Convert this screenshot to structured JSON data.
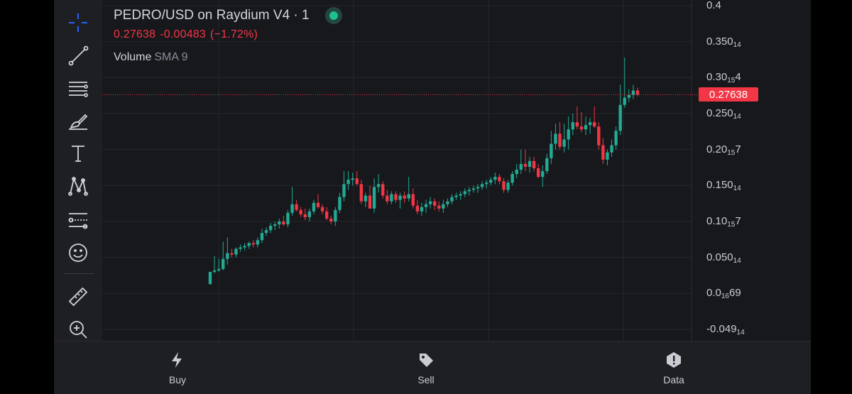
{
  "legend": {
    "symbol": "PEDRO/USD on Raydium V4 · 1",
    "last": "0.27638",
    "change": "-0.00483",
    "change_pct": "(−1.72%)",
    "indicator": "Volume",
    "indicator_param": "SMA 9"
  },
  "toolbar": {
    "tools": [
      "crosshair-icon",
      "trend-line-icon",
      "fib-retracement-icon",
      "brush-icon",
      "text-icon",
      "pattern-icon",
      "forecast-icon",
      "emoji-icon",
      "ruler-icon",
      "zoom-in-icon"
    ]
  },
  "axis": {
    "labels": [
      {
        "main": "0.4",
        "sub": "",
        "tail": ""
      },
      {
        "main": "0.350",
        "sub": "14",
        "tail": ""
      },
      {
        "main": "0.30",
        "sub": "15",
        "tail": "4"
      },
      {
        "main": "0.250",
        "sub": "14",
        "tail": ""
      },
      {
        "main": "0.20",
        "sub": "15",
        "tail": "7"
      },
      {
        "main": "0.150",
        "sub": "14",
        "tail": ""
      },
      {
        "main": "0.10",
        "sub": "15",
        "tail": "7"
      },
      {
        "main": "0.050",
        "sub": "14",
        "tail": ""
      },
      {
        "main": "0.0",
        "sub": "16",
        "tail": "69"
      },
      {
        "main": "-0.049",
        "sub": "14",
        "tail": ""
      }
    ],
    "current_price": "0.27638"
  },
  "colors": {
    "up": "#22ab94",
    "down": "#f23645",
    "grid": "#24262c",
    "background": "#17181c"
  },
  "chart_data": {
    "type": "candlestick",
    "ylim": [
      -0.05,
      0.4
    ],
    "current_price": 0.27638,
    "candles": [
      [
        0.013,
        0.03,
        0.012,
        0.03
      ],
      [
        0.03,
        0.052,
        0.028,
        0.032
      ],
      [
        0.032,
        0.048,
        0.03,
        0.034
      ],
      [
        0.034,
        0.072,
        0.032,
        0.048
      ],
      [
        0.048,
        0.078,
        0.04,
        0.056
      ],
      [
        0.056,
        0.062,
        0.05,
        0.054
      ],
      [
        0.054,
        0.064,
        0.05,
        0.062
      ],
      [
        0.062,
        0.068,
        0.058,
        0.064
      ],
      [
        0.064,
        0.07,
        0.06,
        0.066
      ],
      [
        0.066,
        0.072,
        0.062,
        0.07
      ],
      [
        0.07,
        0.074,
        0.064,
        0.068
      ],
      [
        0.068,
        0.078,
        0.064,
        0.074
      ],
      [
        0.074,
        0.09,
        0.07,
        0.084
      ],
      [
        0.084,
        0.092,
        0.08,
        0.088
      ],
      [
        0.088,
        0.098,
        0.084,
        0.094
      ],
      [
        0.094,
        0.1,
        0.088,
        0.096
      ],
      [
        0.096,
        0.104,
        0.09,
        0.1
      ],
      [
        0.1,
        0.108,
        0.094,
        0.096
      ],
      [
        0.096,
        0.116,
        0.092,
        0.112
      ],
      [
        0.112,
        0.148,
        0.108,
        0.124
      ],
      [
        0.124,
        0.13,
        0.114,
        0.116
      ],
      [
        0.116,
        0.12,
        0.106,
        0.11
      ],
      [
        0.11,
        0.118,
        0.102,
        0.106
      ],
      [
        0.106,
        0.118,
        0.1,
        0.114
      ],
      [
        0.114,
        0.13,
        0.11,
        0.126
      ],
      [
        0.126,
        0.138,
        0.118,
        0.12
      ],
      [
        0.12,
        0.124,
        0.11,
        0.114
      ],
      [
        0.114,
        0.12,
        0.102,
        0.104
      ],
      [
        0.104,
        0.108,
        0.096,
        0.1
      ],
      [
        0.1,
        0.12,
        0.094,
        0.116
      ],
      [
        0.116,
        0.14,
        0.112,
        0.134
      ],
      [
        0.134,
        0.17,
        0.128,
        0.152
      ],
      [
        0.152,
        0.17,
        0.144,
        0.158
      ],
      [
        0.158,
        0.168,
        0.15,
        0.16
      ],
      [
        0.16,
        0.17,
        0.15,
        0.152
      ],
      [
        0.152,
        0.158,
        0.124,
        0.128
      ],
      [
        0.128,
        0.14,
        0.12,
        0.136
      ],
      [
        0.136,
        0.15,
        0.13,
        0.118
      ],
      [
        0.118,
        0.16,
        0.112,
        0.148
      ],
      [
        0.148,
        0.166,
        0.14,
        0.152
      ],
      [
        0.152,
        0.156,
        0.132,
        0.136
      ],
      [
        0.136,
        0.144,
        0.124,
        0.128
      ],
      [
        0.128,
        0.142,
        0.124,
        0.138
      ],
      [
        0.138,
        0.142,
        0.126,
        0.13
      ],
      [
        0.13,
        0.14,
        0.118,
        0.136
      ],
      [
        0.136,
        0.142,
        0.126,
        0.132
      ],
      [
        0.132,
        0.162,
        0.128,
        0.138
      ],
      [
        0.138,
        0.146,
        0.118,
        0.122
      ],
      [
        0.122,
        0.13,
        0.11,
        0.114
      ],
      [
        0.114,
        0.126,
        0.108,
        0.12
      ],
      [
        0.12,
        0.13,
        0.112,
        0.124
      ],
      [
        0.124,
        0.134,
        0.118,
        0.128
      ],
      [
        0.128,
        0.132,
        0.116,
        0.122
      ],
      [
        0.122,
        0.128,
        0.114,
        0.118
      ],
      [
        0.118,
        0.13,
        0.112,
        0.124
      ],
      [
        0.124,
        0.132,
        0.12,
        0.128
      ],
      [
        0.128,
        0.138,
        0.124,
        0.134
      ],
      [
        0.134,
        0.14,
        0.13,
        0.136
      ],
      [
        0.136,
        0.142,
        0.13,
        0.138
      ],
      [
        0.138,
        0.146,
        0.134,
        0.142
      ],
      [
        0.142,
        0.148,
        0.136,
        0.144
      ],
      [
        0.144,
        0.15,
        0.14,
        0.146
      ],
      [
        0.146,
        0.152,
        0.14,
        0.148
      ],
      [
        0.148,
        0.156,
        0.144,
        0.152
      ],
      [
        0.152,
        0.158,
        0.146,
        0.154
      ],
      [
        0.154,
        0.162,
        0.15,
        0.158
      ],
      [
        0.158,
        0.168,
        0.152,
        0.162
      ],
      [
        0.162,
        0.166,
        0.152,
        0.156
      ],
      [
        0.156,
        0.16,
        0.14,
        0.144
      ],
      [
        0.144,
        0.158,
        0.14,
        0.154
      ],
      [
        0.154,
        0.17,
        0.15,
        0.166
      ],
      [
        0.166,
        0.18,
        0.16,
        0.172
      ],
      [
        0.172,
        0.2,
        0.166,
        0.18
      ],
      [
        0.18,
        0.2,
        0.17,
        0.176
      ],
      [
        0.176,
        0.19,
        0.168,
        0.184
      ],
      [
        0.184,
        0.19,
        0.17,
        0.174
      ],
      [
        0.174,
        0.18,
        0.16,
        0.162
      ],
      [
        0.162,
        0.178,
        0.148,
        0.17
      ],
      [
        0.17,
        0.194,
        0.166,
        0.188
      ],
      [
        0.188,
        0.226,
        0.18,
        0.208
      ],
      [
        0.208,
        0.236,
        0.2,
        0.222
      ],
      [
        0.222,
        0.238,
        0.2,
        0.204
      ],
      [
        0.204,
        0.236,
        0.196,
        0.214
      ],
      [
        0.214,
        0.246,
        0.2,
        0.228
      ],
      [
        0.228,
        0.25,
        0.22,
        0.238
      ],
      [
        0.238,
        0.26,
        0.228,
        0.232
      ],
      [
        0.232,
        0.252,
        0.224,
        0.228
      ],
      [
        0.228,
        0.246,
        0.22,
        0.234
      ],
      [
        0.234,
        0.244,
        0.222,
        0.238
      ],
      [
        0.238,
        0.26,
        0.23,
        0.232
      ],
      [
        0.232,
        0.238,
        0.2,
        0.206
      ],
      [
        0.206,
        0.216,
        0.18,
        0.186
      ],
      [
        0.186,
        0.2,
        0.178,
        0.196
      ],
      [
        0.196,
        0.214,
        0.19,
        0.206
      ],
      [
        0.206,
        0.232,
        0.2,
        0.226
      ],
      [
        0.226,
        0.29,
        0.22,
        0.262
      ],
      [
        0.262,
        0.328,
        0.258,
        0.272
      ],
      [
        0.272,
        0.284,
        0.266,
        0.276
      ],
      [
        0.276,
        0.29,
        0.27,
        0.282
      ],
      [
        0.282,
        0.286,
        0.274,
        0.2764
      ]
    ]
  },
  "bottom_nav": [
    {
      "label": "Buy",
      "icon": "lightning-icon"
    },
    {
      "label": "Sell",
      "icon": "tag-icon"
    },
    {
      "label": "Data",
      "icon": "info-icon"
    }
  ]
}
